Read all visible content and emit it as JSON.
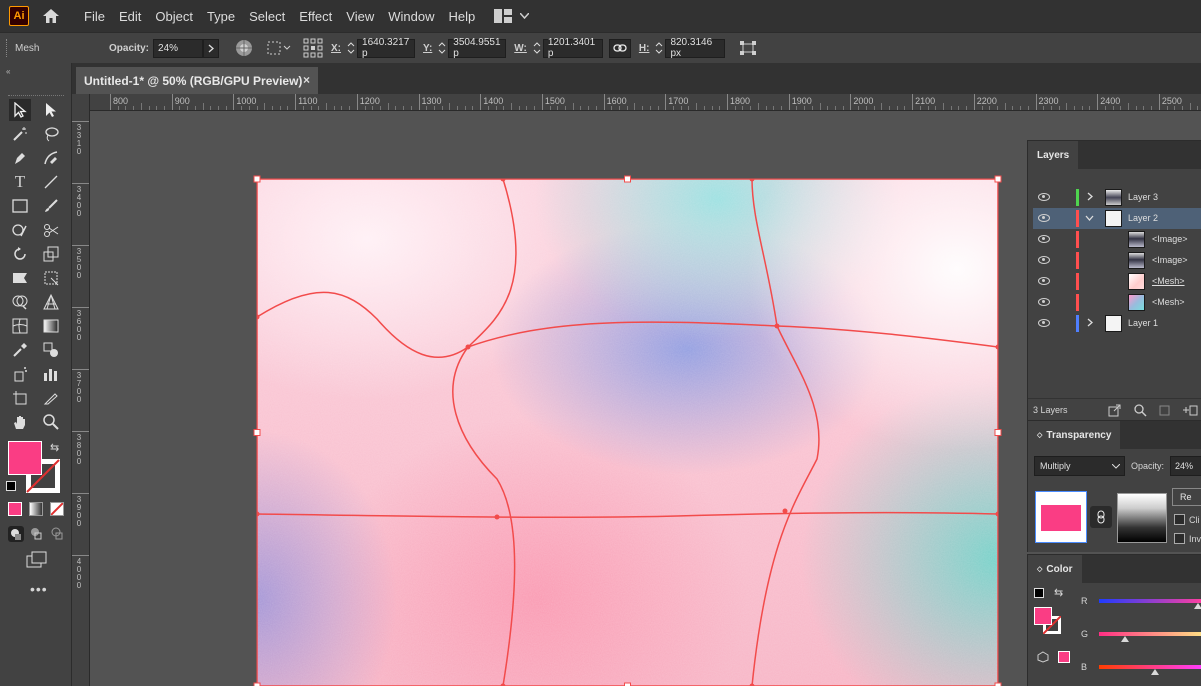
{
  "app": {
    "logo_text": "Ai"
  },
  "menu": [
    "File",
    "Edit",
    "Object",
    "Type",
    "Select",
    "Effect",
    "View",
    "Window",
    "Help"
  ],
  "control": {
    "selection_label": "Mesh",
    "opacity_label": "Opacity:",
    "opacity_value": "24%",
    "x_label": "X:",
    "x_value": "1640.3217 p",
    "y_label": "Y:",
    "y_value": "3504.9551 p",
    "w_label": "W:",
    "w_value": "1201.3401 p",
    "h_label": "H:",
    "h_value": "820.3146 px"
  },
  "document": {
    "tab_title": "Untitled-1* @ 50% (RGB/GPU Preview)",
    "close": "×"
  },
  "ruler": {
    "h_labels": [
      "800",
      "900",
      "1000",
      "1100",
      "1200",
      "1300",
      "1400",
      "1500",
      "1600",
      "1700",
      "1800",
      "1900",
      "2000",
      "2100",
      "2200",
      "2300",
      "2400",
      "2500"
    ],
    "v_labels": [
      "3310",
      "3400",
      "3500",
      "3600",
      "3700",
      "3800",
      "3900",
      "4000"
    ]
  },
  "layers_panel": {
    "tab": "Layers",
    "rows": [
      {
        "name": "Layer 3",
        "color": "#4fd44f",
        "expanded": false,
        "level": 0,
        "selected": false
      },
      {
        "name": "Layer 2",
        "color": "#ff4f4f",
        "expanded": true,
        "level": 0,
        "selected": true
      },
      {
        "name": "<Image>",
        "color": "#ff4f4f",
        "level": 1,
        "selected": false
      },
      {
        "name": "<Image>",
        "color": "#ff4f4f",
        "level": 1,
        "selected": false
      },
      {
        "name": "<Mesh>",
        "color": "#ff4f4f",
        "level": 1,
        "selected": false,
        "underlined": true
      },
      {
        "name": "<Mesh>",
        "color": "#ff4f4f",
        "level": 1,
        "selected": false
      },
      {
        "name": "Layer 1",
        "color": "#4f7fff",
        "expanded": false,
        "level": 0,
        "selected": false
      }
    ],
    "count": "3 Layers"
  },
  "transparency_panel": {
    "tab": "Transparency",
    "blend_mode": "Multiply",
    "opacity_label": "Opacity:",
    "opacity_value": "24%",
    "release_button": "Re",
    "clip_label": "Cli",
    "invert_label": "Inv"
  },
  "color_panel": {
    "tab": "Color",
    "r_label": "R",
    "g_label": "G",
    "b_label": "B",
    "r_value_fraction": 1.0,
    "g_value_fraction": 0.23,
    "b_value_fraction": 0.55
  },
  "colors": {
    "fill": "#fa3d84",
    "mesh_line": "#f24b4b",
    "accent_selected_row": "#4e6177"
  }
}
